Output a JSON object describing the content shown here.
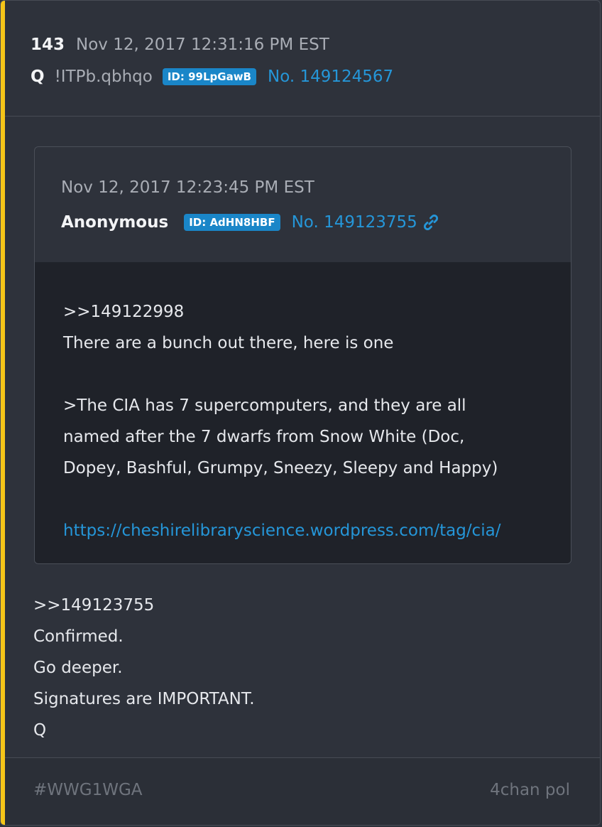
{
  "post": {
    "number": "143",
    "date": "Nov 12, 2017 12:31:16 PM EST",
    "author": "Q",
    "tripcode": "!ITPb.qbhqo",
    "id_badge": "ID: 99LpGawB",
    "post_no": "No. 149124567"
  },
  "quoted": {
    "date": "Nov 12, 2017 12:23:45 PM EST",
    "author": "Anonymous",
    "id_badge": "ID: AdHN8HBF",
    "post_no": "No. 149123755",
    "link_icon": "chain-link-icon",
    "lines": {
      "ref": ">>149122998",
      "l1": "There are a bunch out there, here is one",
      "l2": ">The CIA has 7 supercomputers, and they are all",
      "l3": "named after the 7 dwarfs from Snow White (Doc,",
      "l4": "Dopey, Bashful, Grumpy, Sneezy, Sleepy and Happy)",
      "url": "https://cheshirelibraryscience.wordpress.com/tag/cia/"
    }
  },
  "reply": {
    "ref": ">>149123755",
    "l1": "Confirmed.",
    "l2": "Go deeper.",
    "l3": "Signatures are IMPORTANT.",
    "l4": "Q"
  },
  "footer": {
    "hashtag": "#WWG1WGA",
    "source": "4chan pol"
  },
  "colors": {
    "accent": "#f5c518",
    "link": "#2596d8",
    "badge": "#1a86c8"
  }
}
